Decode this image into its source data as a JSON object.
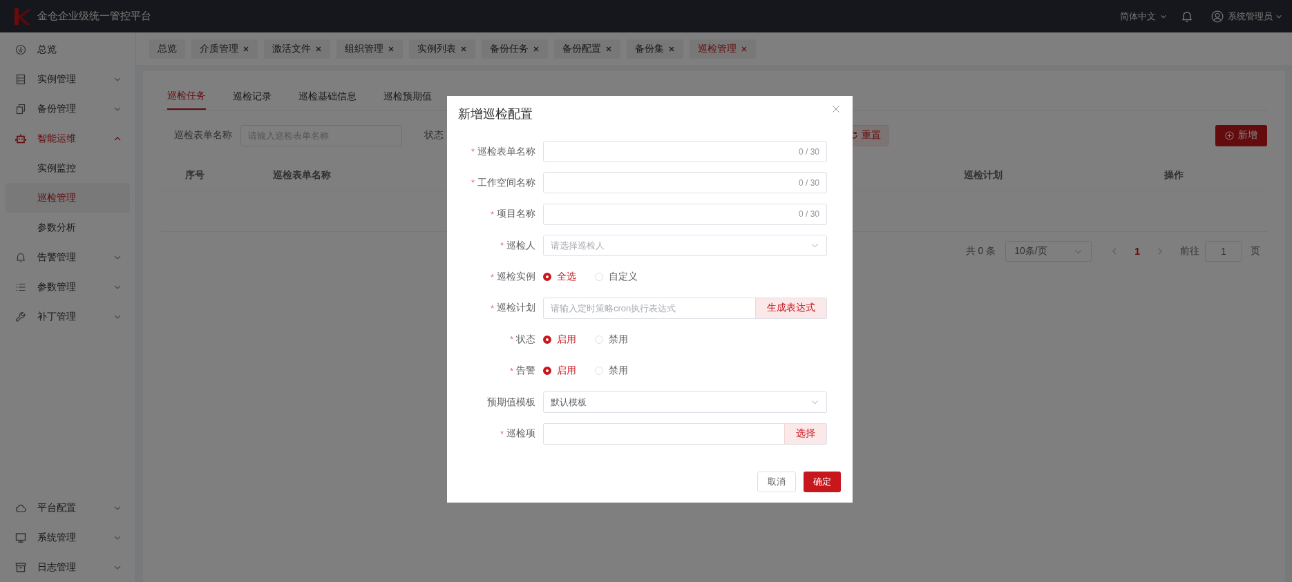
{
  "header": {
    "title": "金仓企业级统一管控平台",
    "language": "简体中文",
    "user": "系统管理员"
  },
  "sidebar": {
    "items": [
      {
        "label": "总览",
        "kind": "link",
        "selected": false
      },
      {
        "label": "实例管理",
        "kind": "group",
        "selected": false,
        "expanded": false
      },
      {
        "label": "备份管理",
        "kind": "group",
        "selected": false,
        "expanded": false
      },
      {
        "label": "智能运维",
        "kind": "group",
        "selected": true,
        "expanded": true,
        "children": [
          {
            "label": "实例监控",
            "selected": false
          },
          {
            "label": "巡检管理",
            "selected": true
          },
          {
            "label": "参数分析",
            "selected": false
          }
        ]
      },
      {
        "label": "告警管理",
        "kind": "group",
        "selected": false,
        "expanded": false
      },
      {
        "label": "参数管理",
        "kind": "group",
        "selected": false,
        "expanded": false
      },
      {
        "label": "补丁管理",
        "kind": "group",
        "selected": false,
        "expanded": false
      }
    ],
    "bottom_items": [
      {
        "label": "平台配置",
        "kind": "group",
        "selected": false,
        "expanded": false
      },
      {
        "label": "系统管理",
        "kind": "group",
        "selected": false,
        "expanded": false
      },
      {
        "label": "日志管理",
        "kind": "group",
        "selected": false,
        "expanded": false
      }
    ]
  },
  "tabs": [
    {
      "label": "总览",
      "closable": false,
      "selected": false
    },
    {
      "label": "介质管理",
      "closable": true,
      "selected": false
    },
    {
      "label": "激活文件",
      "closable": true,
      "selected": false
    },
    {
      "label": "组织管理",
      "closable": true,
      "selected": false
    },
    {
      "label": "实例列表",
      "closable": true,
      "selected": false
    },
    {
      "label": "备份任务",
      "closable": true,
      "selected": false
    },
    {
      "label": "备份配置",
      "closable": true,
      "selected": false
    },
    {
      "label": "备份集",
      "closable": true,
      "selected": false
    },
    {
      "label": "巡检管理",
      "closable": true,
      "selected": true
    }
  ],
  "sub_tabs": [
    {
      "label": "巡检任务",
      "selected": true
    },
    {
      "label": "巡检记录",
      "selected": false
    },
    {
      "label": "巡检基础信息",
      "selected": false
    },
    {
      "label": "巡检预期值",
      "selected": false
    }
  ],
  "filter": {
    "label": "巡检表单名称",
    "placeholder": "请输入巡检表单名称",
    "status_label": "状态",
    "reset_button": "重置",
    "add_button": "新增"
  },
  "table": {
    "columns": [
      "序号",
      "巡检表单名称",
      "巡检计划",
      "操作"
    ]
  },
  "pagination": {
    "total": "共 0 条",
    "page_size": "10条/页",
    "pages": [
      {
        "label": "1",
        "selected": true
      }
    ],
    "goto_label": "前往",
    "goto_value": "1",
    "suffix": "页"
  },
  "modal": {
    "title": "新增巡检配置",
    "fields": [
      {
        "label": "巡检表单名称",
        "mark": "*",
        "kind": "text",
        "counter": "0 / 30"
      },
      {
        "label": "工作空间名称",
        "mark": "*",
        "kind": "text",
        "counter": "0 / 30"
      },
      {
        "label": "项目名称",
        "mark": "*",
        "kind": "text",
        "counter": "0 / 30"
      },
      {
        "label": "巡检人",
        "mark": "*",
        "kind": "select",
        "placeholder": "请选择巡检人"
      },
      {
        "label": "巡检实例",
        "mark": "*",
        "kind": "radio",
        "options": [
          {
            "label": "全选",
            "selected": true
          },
          {
            "label": "自定义",
            "selected": false
          }
        ]
      },
      {
        "label": "巡检计划",
        "mark": "*",
        "kind": "input_button",
        "placeholder": "请输入定时策略cron执行表达式",
        "button": "生成表达式"
      },
      {
        "label": "状态",
        "mark": "*",
        "kind": "radio",
        "options": [
          {
            "label": "启用",
            "selected": true
          },
          {
            "label": "禁用",
            "selected": false
          }
        ]
      },
      {
        "label": "告警",
        "mark": "*",
        "kind": "radio",
        "options": [
          {
            "label": "启用",
            "selected": true
          },
          {
            "label": "禁用",
            "selected": false
          }
        ]
      },
      {
        "label": "预期值模板",
        "kind": "select",
        "value": "默认模板"
      },
      {
        "label": "巡检项",
        "mark": "*",
        "kind": "input_button",
        "button": "选择"
      }
    ],
    "cancel_button": "取消",
    "confirm_button": "确定"
  }
}
